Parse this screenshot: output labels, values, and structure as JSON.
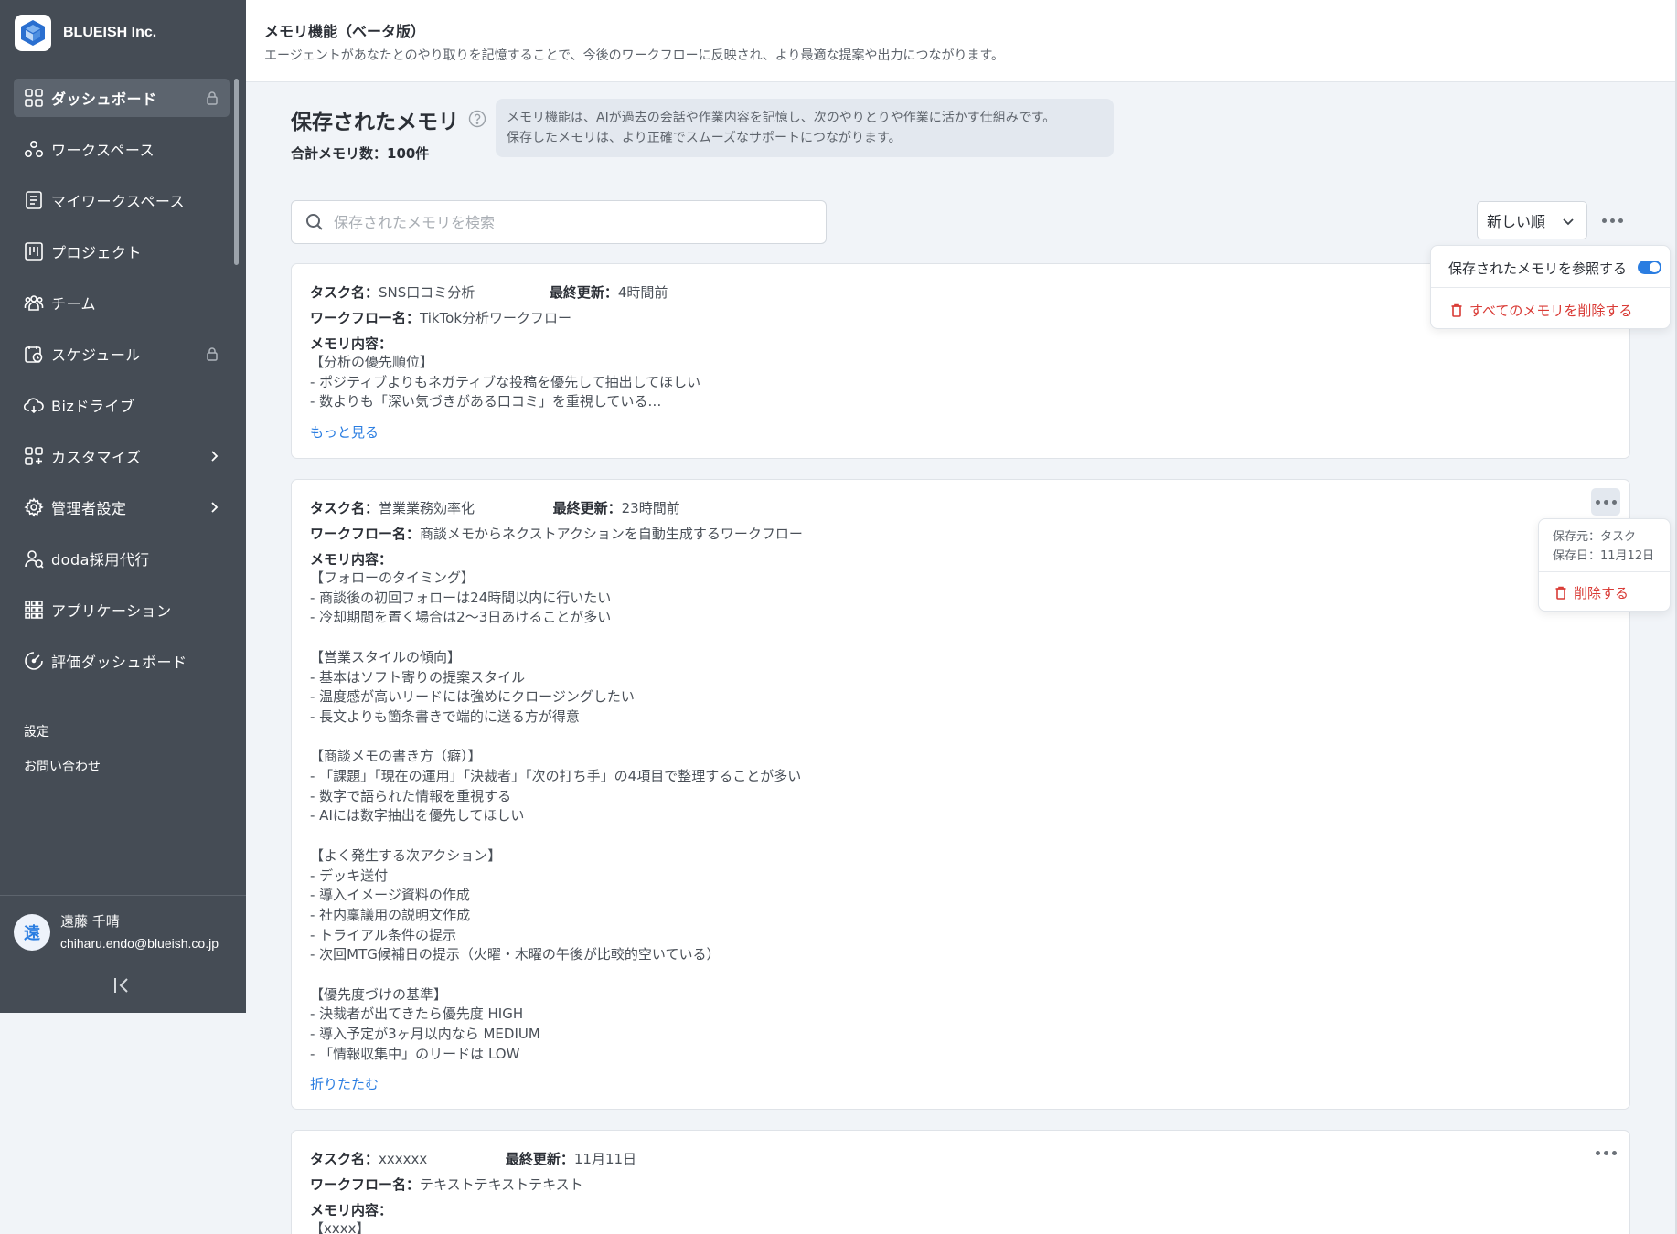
{
  "sidebar": {
    "company": "BLUEISH Inc.",
    "nav": [
      {
        "label": "ダッシュボード",
        "icon": "dashboard-icon",
        "active": true,
        "end": "lock"
      },
      {
        "label": "ワークスペース",
        "icon": "workspace-icon",
        "active": false,
        "end": ""
      },
      {
        "label": "マイワークスペース",
        "icon": "my-workspace-icon",
        "active": false,
        "end": ""
      },
      {
        "label": "プロジェクト",
        "icon": "project-icon",
        "active": false,
        "end": ""
      },
      {
        "label": "チーム",
        "icon": "team-icon",
        "active": false,
        "end": ""
      },
      {
        "label": "スケジュール",
        "icon": "schedule-icon",
        "active": false,
        "end": "lock"
      },
      {
        "label": "Bizドライブ",
        "icon": "cloud-drive-icon",
        "active": false,
        "end": ""
      },
      {
        "label": "カスタマイズ",
        "icon": "customize-icon",
        "active": false,
        "end": "chevron"
      },
      {
        "label": "管理者設定",
        "icon": "gear-icon",
        "active": false,
        "end": "chevron"
      },
      {
        "label": "doda採用代行",
        "icon": "recruit-icon",
        "active": false,
        "end": ""
      },
      {
        "label": "アプリケーション",
        "icon": "apps-grid-icon",
        "active": false,
        "end": ""
      },
      {
        "label": "評価ダッシュボード",
        "icon": "gauge-icon",
        "active": false,
        "end": ""
      }
    ],
    "settings_label": "設定",
    "contact_label": "お問い合わせ",
    "user": {
      "avatar": "遠",
      "name": "遠藤 千晴",
      "email": "chiharu.endo@blueish.co.jp"
    }
  },
  "header": {
    "title": "メモリ機能（ベータ版）",
    "description": "エージェントがあなたとのやり取りを記憶することで、今後のワークフローに反映され、より最適な提案や出力につながります。"
  },
  "memory": {
    "title": "保存されたメモリ",
    "total": "合計メモリ数：100件",
    "info_line1": "メモリ機能は、AIが過去の会話や作業内容を記憶し、次のやりとりや作業に活かす仕組みです。",
    "info_line2": "保存したメモリは、より正確でスムーズなサポートにつながります。",
    "search_placeholder": "保存されたメモリを検索",
    "sort_label": "新しい順"
  },
  "options_menu": {
    "reference_label": "保存されたメモリを参照する",
    "reference_on": true,
    "delete_all_label": "すべてのメモリを削除する"
  },
  "labels": {
    "task": "タスク名：",
    "updated": "最終更新：",
    "workflow": "ワークフロー名：",
    "content": "メモリ内容："
  },
  "cards": [
    {
      "task": "SNS口コミ分析",
      "updated": "4時間前",
      "workflow": "TikTok分析ワークフロー",
      "content": "【分析の優先順位】\n- ポジティブよりもネガティブな投稿を優先して抽出してほしい\n- 数よりも「深い気づきがある口コミ」を重視している…",
      "link": "もっと見る"
    },
    {
      "task": "営業業務効率化",
      "updated": "23時間前",
      "workflow": "商談メモからネクストアクションを自動生成するワークフロー",
      "content": "【フォローのタイミング】\n- 商談後の初回フォローは24時間以内に行いたい\n- 冷却期間を置く場合は2〜3日あけることが多い\n\n【営業スタイルの傾向】\n- 基本はソフト寄りの提案スタイル\n- 温度感が高いリードには強めにクロージングしたい\n- 長文よりも箇条書きで端的に送る方が得意\n\n【商談メモの書き方（癖）】\n- 「課題」「現在の運用」「決裁者」「次の打ち手」の4項目で整理することが多い\n- 数字で語られた情報を重視する\n- AIには数字抽出を優先してほしい\n\n【よく発生する次アクション】\n- デッキ送付\n- 導入イメージ資料の作成\n- 社内稟議用の説明文作成\n- トライアル条件の提示\n- 次回MTG候補日の提示（火曜・木曜の午後が比較的空いている）\n\n【優先度づけの基準】\n- 決裁者が出てきたら優先度 HIGH\n- 導入予定が3ヶ月以内なら MEDIUM\n- 「情報収集中」のリードは LOW",
      "link": "折りたたむ"
    },
    {
      "task": "xxxxxx",
      "updated": "11月11日",
      "workflow": "テキストテキストテキスト",
      "content": "【xxxx】",
      "link": ""
    }
  ],
  "card_menu": {
    "source": "保存元：タスク",
    "date": "保存日：11月12日",
    "delete_label": "削除する"
  }
}
